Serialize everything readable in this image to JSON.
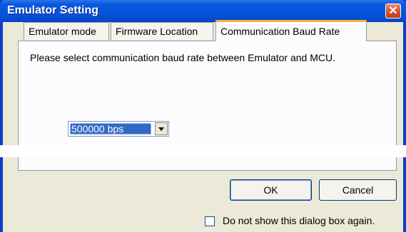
{
  "window": {
    "title": "Emulator Setting",
    "close_label": "✕"
  },
  "tabs": [
    {
      "label": "Emulator mode",
      "selected": false
    },
    {
      "label": "Firmware Location",
      "selected": false
    },
    {
      "label": "Communication Baud Rate",
      "selected": true
    }
  ],
  "panel": {
    "instruction": "Please select communication baud rate between Emulator and MCU.",
    "baud_rate": {
      "selected_value": "500000 bps"
    }
  },
  "buttons": {
    "ok_label": "OK",
    "cancel_label": "Cancel"
  },
  "dont_show_again": {
    "label": "Do not show this dialog box again.",
    "checked": false
  },
  "colors": {
    "titlebar": "#0654dc",
    "close_button": "#d9502c",
    "dialog_face": "#ece9d8",
    "selection": "#316ac5",
    "active_tab_accent": "#f5b334"
  }
}
